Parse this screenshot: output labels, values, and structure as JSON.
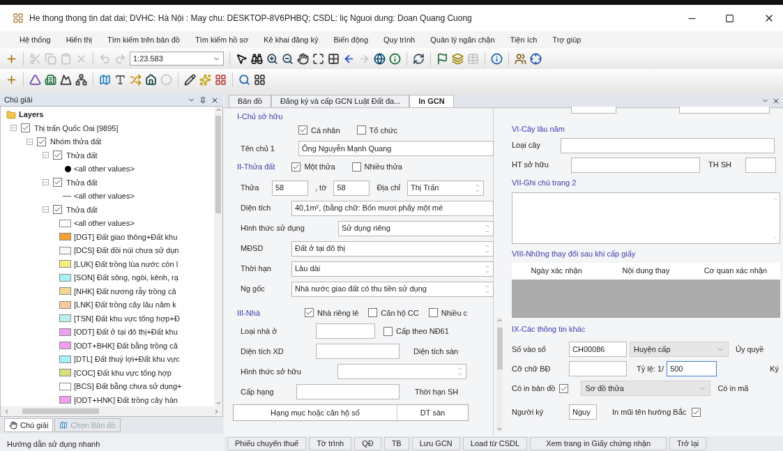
{
  "window": {
    "title": "He thong thong tin dat dai; DVHC: Hà Nội : May chu: DESKTOP-8V6PHBQ; CSDL: liç Nguoi dung: Doan Quang Cuong"
  },
  "menu": [
    "Hệ thống",
    "Hiển thị",
    "Tìm kiếm trên bản đồ",
    "Tìm kiếm hồ sơ",
    "Kê khai đăng ký",
    "Biến động",
    "Quy trình",
    "Quản lý ngăn chặn",
    "Tiện ích",
    "Trợ giúp"
  ],
  "toolbar_1": {
    "scale": "1:23.583",
    "items": [
      {
        "kind": "add",
        "disabled": false
      },
      {
        "kind": "sep"
      },
      {
        "kind": "cut",
        "disabled": true
      },
      {
        "kind": "copy",
        "disabled": true
      },
      {
        "kind": "paste",
        "disabled": true
      },
      {
        "kind": "delete",
        "disabled": true
      },
      {
        "kind": "sep"
      },
      {
        "kind": "undo",
        "disabled": true
      },
      {
        "kind": "redo",
        "disabled": true
      },
      {
        "kind": "scale"
      },
      {
        "kind": "sep"
      },
      {
        "kind": "pointer",
        "disabled": false
      },
      {
        "kind": "binoculars",
        "disabled": false
      },
      {
        "kind": "zoom-in",
        "disabled": false
      },
      {
        "kind": "zoom-out",
        "disabled": false
      },
      {
        "kind": "hand",
        "disabled": false
      },
      {
        "kind": "extent",
        "disabled": false
      },
      {
        "kind": "grid",
        "disabled": false
      },
      {
        "kind": "back",
        "disabled": false
      },
      {
        "kind": "forward",
        "disabled": true
      },
      {
        "kind": "globe",
        "disabled": false
      },
      {
        "kind": "info",
        "disabled": false
      },
      {
        "kind": "sep"
      },
      {
        "kind": "refresh",
        "disabled": false
      },
      {
        "kind": "sep"
      },
      {
        "kind": "flag",
        "disabled": false
      },
      {
        "kind": "layers",
        "disabled": false
      },
      {
        "kind": "table",
        "disabled": true
      },
      {
        "kind": "sep"
      },
      {
        "kind": "help",
        "disabled": false
      },
      {
        "kind": "sep"
      },
      {
        "kind": "users",
        "disabled": false
      },
      {
        "kind": "xy",
        "disabled": false
      }
    ]
  },
  "toolbar_2": {
    "items": [
      {
        "kind": "add",
        "disabled": false
      },
      {
        "kind": "sep"
      },
      {
        "kind": "shape",
        "disabled": false
      },
      {
        "kind": "building",
        "disabled": false
      },
      {
        "kind": "mountain",
        "disabled": false
      },
      {
        "kind": "network",
        "disabled": false
      },
      {
        "kind": "sep"
      },
      {
        "kind": "map",
        "disabled": false
      },
      {
        "kind": "text",
        "disabled": false
      },
      {
        "kind": "shuffle",
        "disabled": false
      },
      {
        "kind": "home",
        "disabled": false
      },
      {
        "kind": "dot",
        "disabled": true
      },
      {
        "kind": "sep"
      },
      {
        "kind": "pen",
        "disabled": false
      },
      {
        "kind": "sparkle",
        "disabled": false
      },
      {
        "kind": "scatter",
        "disabled": false
      },
      {
        "kind": "sep"
      },
      {
        "kind": "search",
        "disabled": false
      },
      {
        "kind": "windows",
        "disabled": false
      }
    ]
  },
  "legend_panel": {
    "title": "Chú giải",
    "tree": [
      {
        "kind": "root",
        "label": "Layers",
        "children": [
          {
            "kind": "group",
            "label": "Thị trấn Quốc Oai [9895]",
            "checked": true,
            "expanded": true,
            "children": [
              {
                "kind": "group",
                "label": "Nhóm thửa đất",
                "checked": true,
                "expanded": true,
                "children": [
                  {
                    "kind": "group",
                    "label": "Thửa đất",
                    "checked": true,
                    "expanded": true,
                    "children": [
                      {
                        "kind": "point",
                        "label": "<all other values>",
                        "color": "#000000"
                      }
                    ]
                  },
                  {
                    "kind": "group",
                    "label": "Thửa đất",
                    "checked": true,
                    "expanded": true,
                    "children": [
                      {
                        "kind": "line",
                        "label": "<all other values>",
                        "color": "#555555"
                      }
                    ]
                  },
                  {
                    "kind": "group",
                    "label": "Thửa đất",
                    "checked": true,
                    "expanded": true,
                    "children": [
                      {
                        "kind": "fill",
                        "label": "<all other values>",
                        "color": "#ffffff"
                      },
                      {
                        "kind": "fill",
                        "label": "[DGT] Đất giao thông+Đất khu",
                        "color": "#f5a030"
                      },
                      {
                        "kind": "fill",
                        "label": "[DCS] Đất đồi núi chưa sử dụn",
                        "color": "#fbf6fb"
                      },
                      {
                        "kind": "fill",
                        "label": "[LUK] Đất trồng lúa nước còn l",
                        "color": "#f5f07a"
                      },
                      {
                        "kind": "fill",
                        "label": "[SON] Đất sông, ngòi, kênh, rạ",
                        "color": "#a8f0f8"
                      },
                      {
                        "kind": "fill",
                        "label": "[NHK] Đất nương rẫy trồng câ",
                        "color": "#f0d890"
                      },
                      {
                        "kind": "fill",
                        "label": "[LNK] Đất trồng cây lâu năm k",
                        "color": "#f5c8a0"
                      },
                      {
                        "kind": "fill",
                        "label": "[TSN] Đất khu vực tổng hợp+Đ",
                        "color": "#b8f0f0"
                      },
                      {
                        "kind": "fill",
                        "label": "[ODT] Đất ở tại đô thị+Đất khu",
                        "color": "#f0a0f0"
                      },
                      {
                        "kind": "fill",
                        "label": "[ODT+BHK] Đất bằng trồng câ",
                        "color": "#f09ef0"
                      },
                      {
                        "kind": "fill",
                        "label": "[DTL] Đất thuỷ lợi+Đất khu vực",
                        "color": "#a8f0f9"
                      },
                      {
                        "kind": "fill",
                        "label": "[COC] Đất khu vực tổng hợp",
                        "color": "#d8e080"
                      },
                      {
                        "kind": "fill",
                        "label": "[BCS] Đất bằng chưa sử dụng+",
                        "color": "#fffffe"
                      },
                      {
                        "kind": "fill",
                        "label": "[ODT+HNK] Đất trồng cây hàn",
                        "color": "#f0a0f1"
                      }
                    ]
                  }
                ]
              }
            ]
          }
        ]
      }
    ],
    "tabs": [
      {
        "label": "Chú giải",
        "selected": true
      },
      {
        "label": "Chọn Bản đồ",
        "selected": false
      }
    ],
    "status": "Hướng dẫn sử dụng nhanh"
  },
  "doc_tabs": [
    {
      "label": "Bản đồ",
      "selected": false
    },
    {
      "label": "Đăng ký và cấp GCN Luật Đất đa...",
      "selected": false
    },
    {
      "label": "In GCN",
      "selected": true
    }
  ],
  "owner": {
    "title": "I-Chủ sở hữu",
    "options": [
      {
        "label": "Cá nhân",
        "checked": true
      },
      {
        "label": "Tổ chức",
        "checked": false
      }
    ],
    "name_label": "Tên chủ 1",
    "name_value": "Ông Nguyễn Mạnh Quang"
  },
  "parcel": {
    "title": "II-Thửa đất",
    "options": [
      {
        "label": "Một thửa",
        "checked": true
      },
      {
        "label": "Nhiều thửa",
        "checked": false
      }
    ],
    "parcel_label": "Thửa",
    "parcel_value": "58",
    "sheet_label": ", tờ",
    "sheet_value": "58",
    "address_label": "Địa chỉ",
    "address_value": "Thị Trấn",
    "area_label": "Diện tích",
    "area_value": "40,1m², (bằng chữ: Bốn mươi phẩy một mé",
    "fields": [
      {
        "label": "Hình thức sử dụng",
        "value": "Sử dụng riêng"
      },
      {
        "label": "MĐSD",
        "value": "Đất ở tại đô thị"
      },
      {
        "label": "Thời hạn",
        "value": "Lâu dài"
      },
      {
        "label": "Ng gốc",
        "value": "Nhà nước giao đất có thu tiền sử dụng"
      }
    ]
  },
  "house": {
    "title": "III-Nhà",
    "options": [
      {
        "label": "Nhà riêng lẻ",
        "checked": true
      },
      {
        "label": "Căn hộ CC",
        "checked": false
      },
      {
        "label": "Nhiều c",
        "checked": false
      }
    ],
    "type_label": "Loại nhà ở",
    "decree_option": {
      "label": "Cấp theo NĐ61",
      "checked": false
    },
    "area_label": "Diện tích XD",
    "floor_area_label": "Diện tích sàn",
    "ownership_label": "Hình thức sở hữu",
    "grade_label": "Cấp hạng",
    "term_label": "Thời hạn SH",
    "columns": [
      "Hạng mục hoặc căn hộ số",
      "DT sàn"
    ]
  },
  "perennial": {
    "title": "VI-Cây lâu năm",
    "type_label": "Loại cây",
    "ownership_label": "HT sở hữu",
    "term_label": "TH SH"
  },
  "notes": {
    "title": "VII-Ghi chú trang 2"
  },
  "changes": {
    "title": "VIII-Những thay đổi sau khi cấp giấy",
    "columns": [
      "Ngày xác nhận",
      "Nội dung thay",
      "Cơ quan xác nhận"
    ]
  },
  "other": {
    "title": "IX-Các thông tin khác",
    "book_label": "Số vào sổ",
    "book_value": "CH00086",
    "level_value": "Huyện cấp",
    "authorized_label": "Ủy quyề",
    "font_label": "Cỡ chữ BĐ",
    "scale_label": "Tỷ lệ: 1/",
    "scale_value": "500",
    "sign_label": "Ký",
    "print_map_label": "Có in bản đồ",
    "print_map": true,
    "map_value": "Sơ đồ thửa",
    "print_code_label": "Có in mã",
    "signer_label": "Người ký",
    "signer_value": "Nguy",
    "arrow_label": "In mũi tên hướng Bắc",
    "arrow": true
  },
  "buttons": [
    "Phiếu chuyển thuế",
    "Tờ trình",
    "QĐ",
    "TB",
    "Lưu GCN",
    "Load từ CSDL",
    "Xem trang in Giấy chứng nhận",
    "Trở lại"
  ]
}
